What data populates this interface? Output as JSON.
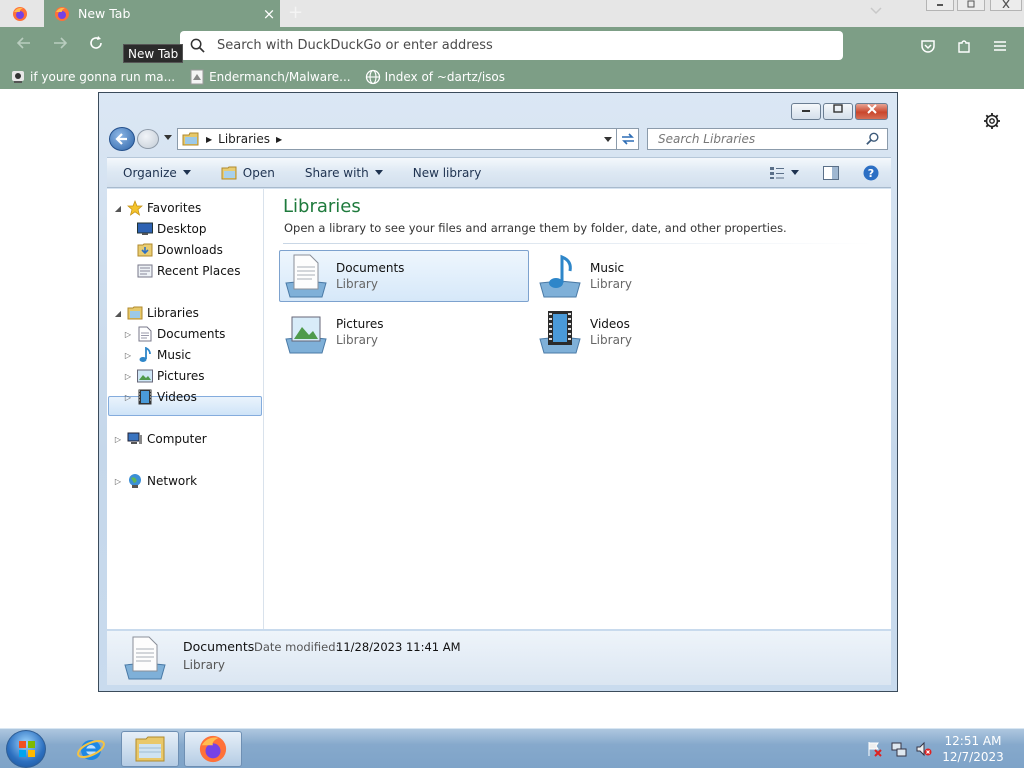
{
  "browser": {
    "tab": {
      "title": "New Tab",
      "close_glyph": "×"
    },
    "new_tab_glyph": "+",
    "tooltip": "New Tab",
    "url_placeholder": "Search with DuckDuckGo or enter address",
    "bookmarks": [
      {
        "label": "if youre gonna run ma...",
        "icon": "bookmark-person-icon"
      },
      {
        "label": "Endermanch/Malware...",
        "icon": "bookmark-page-icon"
      },
      {
        "label": "Index of ~dartz/isos",
        "icon": "bookmark-globe-icon"
      }
    ],
    "accent": "#7d9e86"
  },
  "explorer": {
    "address": {
      "crumb": "Libraries"
    },
    "search_placeholder": "Search Libraries",
    "commands": {
      "organize": "Organize",
      "open": "Open",
      "share_with": "Share with",
      "new_library": "New library"
    },
    "nav": {
      "favorites": "Favorites",
      "desktop": "Desktop",
      "downloads": "Downloads",
      "recent_places": "Recent Places",
      "libraries": "Libraries",
      "documents": "Documents",
      "music": "Music",
      "pictures": "Pictures",
      "videos": "Videos",
      "computer": "Computer",
      "network": "Network"
    },
    "content": {
      "title": "Libraries",
      "subtitle": "Open a library to see your files and arrange them by folder, date, and other properties.",
      "items": [
        {
          "name": "Documents",
          "kind": "Library",
          "selected": true
        },
        {
          "name": "Music",
          "kind": "Library",
          "selected": false
        },
        {
          "name": "Pictures",
          "kind": "Library",
          "selected": false
        },
        {
          "name": "Videos",
          "kind": "Library",
          "selected": false
        }
      ]
    },
    "details": {
      "name": "Documents",
      "date_label": "Date modified:",
      "date_value": "11/28/2023 11:41 AM",
      "kind": "Library"
    }
  },
  "taskbar": {
    "time": "12:51 AM",
    "date": "12/7/2023"
  }
}
